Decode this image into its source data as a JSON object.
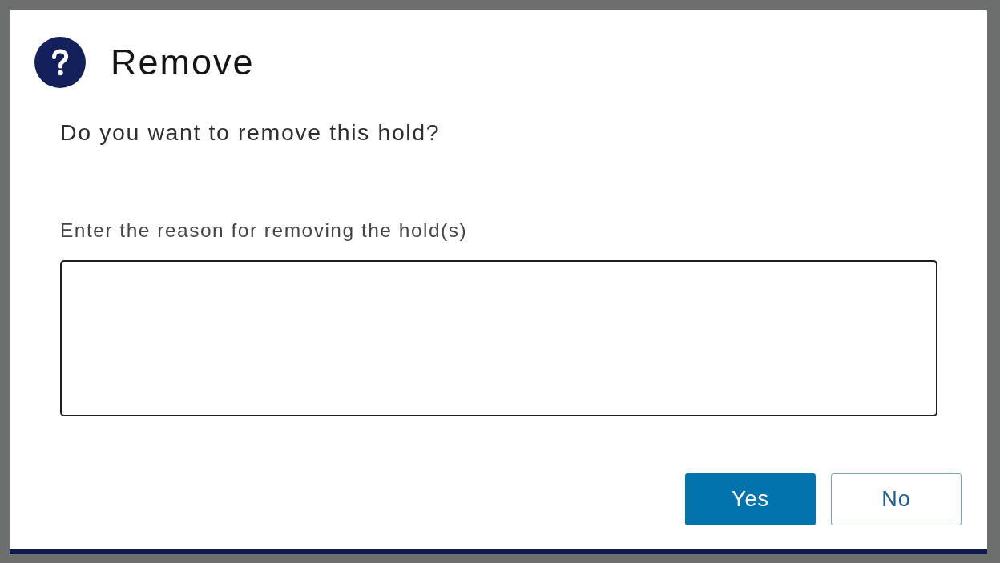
{
  "dialog": {
    "title": "Remove",
    "message": "Do you want to remove this hold?",
    "reason_field": {
      "label": "Enter the reason for removing the hold(s)"
    },
    "buttons": [
      {
        "label": "Yes",
        "kind": "primary"
      },
      {
        "label": "No",
        "kind": "secondary"
      }
    ]
  }
}
